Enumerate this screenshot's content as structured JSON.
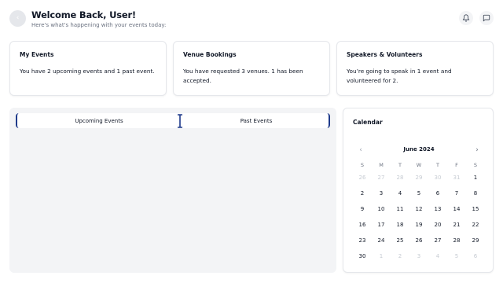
{
  "header": {
    "title": "Welcome Back, User!",
    "subtitle": "Here's what's happening with your events today:"
  },
  "cards": [
    {
      "title": "My Events",
      "text": "You have 2 upcoming events and 1 past event."
    },
    {
      "title": "Venue Bookings",
      "text": "You have requested 3 venues. 1 has been accepted."
    },
    {
      "title": "Speakers & Volunteers",
      "text": "You’re going to speak in 1 event and volunteered for 2."
    }
  ],
  "events": {
    "tabs": [
      {
        "label": "Upcoming Events"
      },
      {
        "label": "Past Events"
      }
    ]
  },
  "calendar": {
    "title": "Calendar",
    "month": "June 2024",
    "prev_icon": "chevron-left-icon",
    "next_icon": "chevron-right-icon",
    "weekdays": [
      "S",
      "M",
      "T",
      "W",
      "T",
      "F",
      "S"
    ],
    "days": [
      {
        "d": "26",
        "muted": true
      },
      {
        "d": "27",
        "muted": true
      },
      {
        "d": "28",
        "muted": true
      },
      {
        "d": "29",
        "muted": true
      },
      {
        "d": "30",
        "muted": true
      },
      {
        "d": "31",
        "muted": true
      },
      {
        "d": "1",
        "muted": false
      },
      {
        "d": "2",
        "muted": false
      },
      {
        "d": "3",
        "muted": false
      },
      {
        "d": "4",
        "muted": false
      },
      {
        "d": "5",
        "muted": false
      },
      {
        "d": "6",
        "muted": false
      },
      {
        "d": "7",
        "muted": false
      },
      {
        "d": "8",
        "muted": false
      },
      {
        "d": "9",
        "muted": false
      },
      {
        "d": "10",
        "muted": false
      },
      {
        "d": "11",
        "muted": false
      },
      {
        "d": "12",
        "muted": false
      },
      {
        "d": "13",
        "muted": false
      },
      {
        "d": "14",
        "muted": false
      },
      {
        "d": "15",
        "muted": false
      },
      {
        "d": "16",
        "muted": false
      },
      {
        "d": "17",
        "muted": false
      },
      {
        "d": "18",
        "muted": false
      },
      {
        "d": "19",
        "muted": false
      },
      {
        "d": "20",
        "muted": false
      },
      {
        "d": "21",
        "muted": false
      },
      {
        "d": "22",
        "muted": false
      },
      {
        "d": "23",
        "muted": false
      },
      {
        "d": "24",
        "muted": false
      },
      {
        "d": "25",
        "muted": false
      },
      {
        "d": "26",
        "muted": false
      },
      {
        "d": "27",
        "muted": false
      },
      {
        "d": "28",
        "muted": false
      },
      {
        "d": "29",
        "muted": false
      },
      {
        "d": "30",
        "muted": false
      },
      {
        "d": "1",
        "muted": true
      },
      {
        "d": "2",
        "muted": true
      },
      {
        "d": "3",
        "muted": true
      },
      {
        "d": "4",
        "muted": true
      },
      {
        "d": "5",
        "muted": true
      },
      {
        "d": "6",
        "muted": true
      }
    ]
  },
  "icons": {
    "avatar": "chevron-left-icon",
    "notifications": "bell-icon",
    "messages": "message-square-icon"
  },
  "colors": {
    "tab_accent": "#1e3a8a",
    "panel_bg": "#f3f4f6",
    "muted_text": "#6b7280"
  }
}
